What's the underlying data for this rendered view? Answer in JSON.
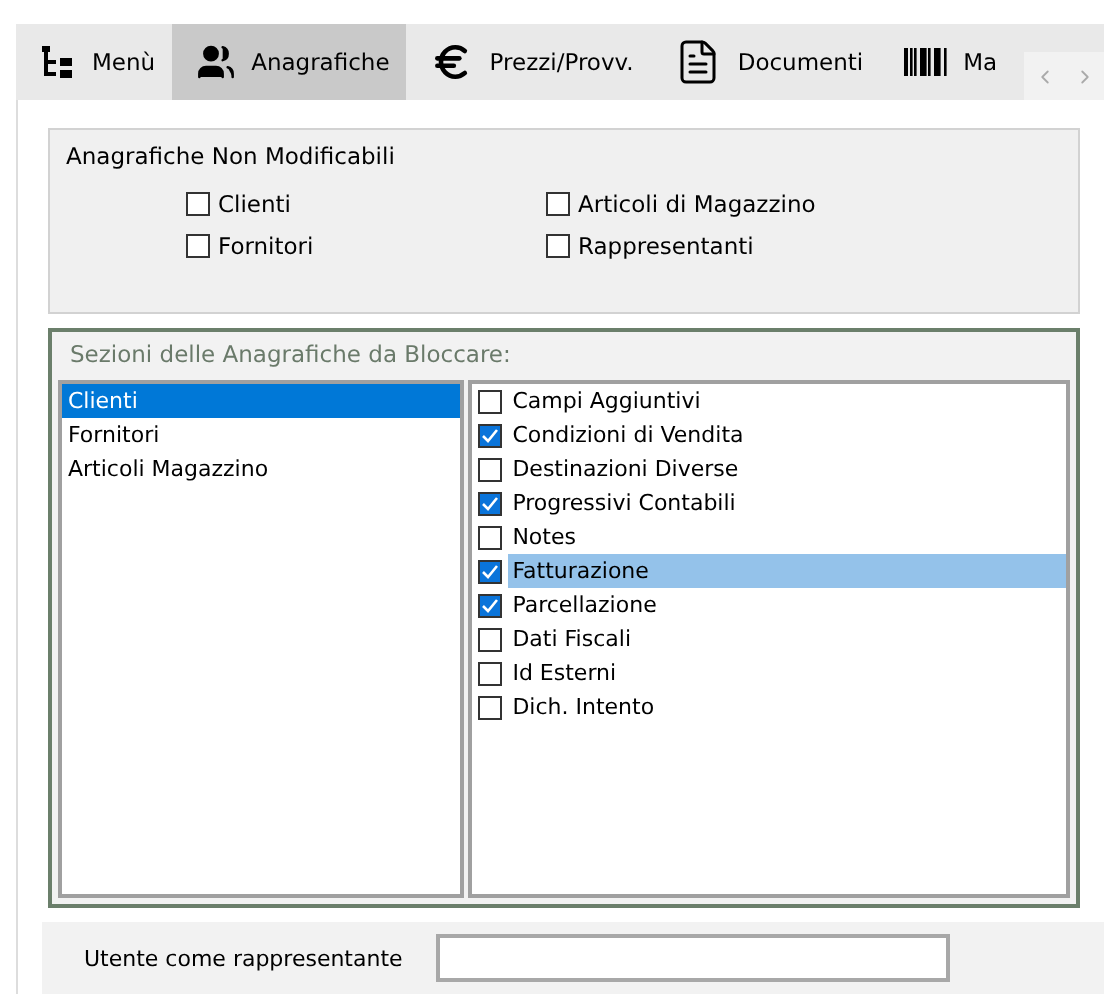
{
  "tabs": [
    {
      "label": "Menù",
      "kind": "tree",
      "selected": false
    },
    {
      "label": "Anagrafiche",
      "kind": "people",
      "selected": true
    },
    {
      "label": "Prezzi/Provv.",
      "kind": "euro",
      "selected": false
    },
    {
      "label": "Documenti",
      "kind": "document",
      "selected": false
    },
    {
      "label": "Ma",
      "kind": "barcode",
      "selected": false
    }
  ],
  "non_editable": {
    "title": "Anagrafiche Non Modificabili",
    "options": [
      {
        "label": "Clienti",
        "checked": false
      },
      {
        "label": "Articoli di Magazzino",
        "checked": false
      },
      {
        "label": "Fornitori",
        "checked": false
      },
      {
        "label": "Rappresentanti",
        "checked": false
      }
    ]
  },
  "lock_sections": {
    "title": "Sezioni delle Anagrafiche da Bloccare:",
    "registries": [
      {
        "label": "Clienti",
        "selected": true
      },
      {
        "label": "Fornitori",
        "selected": false
      },
      {
        "label": "Articoli Magazzino",
        "selected": false
      }
    ],
    "sections": [
      {
        "label": "Campi Aggiuntivi",
        "checked": false,
        "selected": false
      },
      {
        "label": "Condizioni di Vendita",
        "checked": true,
        "selected": false
      },
      {
        "label": "Destinazioni Diverse",
        "checked": false,
        "selected": false
      },
      {
        "label": "Progressivi Contabili",
        "checked": true,
        "selected": false
      },
      {
        "label": "Notes",
        "checked": false,
        "selected": false
      },
      {
        "label": "Fatturazione",
        "checked": true,
        "selected": true
      },
      {
        "label": "Parcellazione",
        "checked": true,
        "selected": false
      },
      {
        "label": "Dati Fiscali",
        "checked": false,
        "selected": false
      },
      {
        "label": "Id Esterni",
        "checked": false,
        "selected": false
      },
      {
        "label": "Dich. Intento",
        "checked": false,
        "selected": false
      }
    ]
  },
  "representative_user": {
    "label": "Utente come rappresentante"
  }
}
